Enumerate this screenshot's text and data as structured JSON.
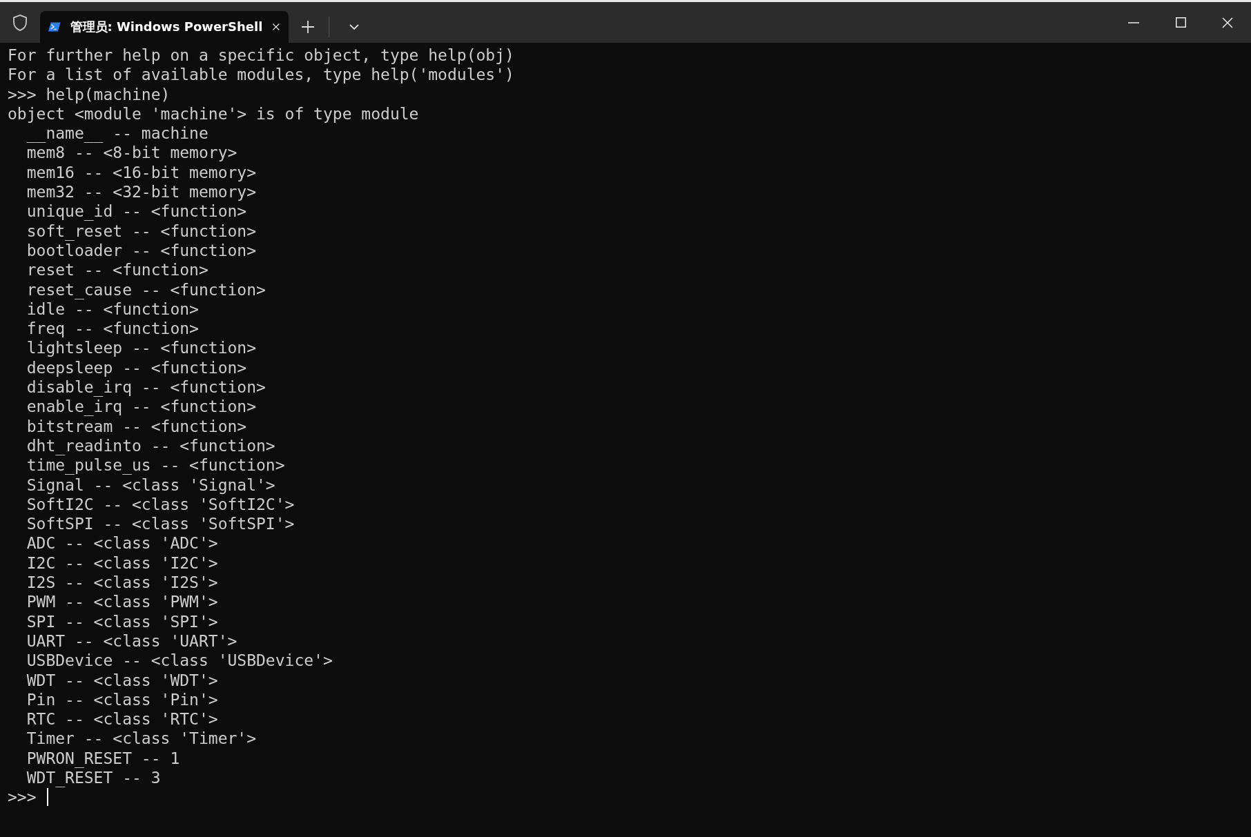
{
  "tab": {
    "title": "管理员: Windows PowerShell",
    "selected": true
  },
  "terminal": {
    "lines": [
      "For further help on a specific object, type help(obj)",
      "For a list of available modules, type help('modules')",
      ">>> help(machine)",
      "object <module 'machine'> is of type module",
      "  __name__ -- machine",
      "  mem8 -- <8-bit memory>",
      "  mem16 -- <16-bit memory>",
      "  mem32 -- <32-bit memory>",
      "  unique_id -- <function>",
      "  soft_reset -- <function>",
      "  bootloader -- <function>",
      "  reset -- <function>",
      "  reset_cause -- <function>",
      "  idle -- <function>",
      "  freq -- <function>",
      "  lightsleep -- <function>",
      "  deepsleep -- <function>",
      "  disable_irq -- <function>",
      "  enable_irq -- <function>",
      "  bitstream -- <function>",
      "  dht_readinto -- <function>",
      "  time_pulse_us -- <function>",
      "  Signal -- <class 'Signal'>",
      "  SoftI2C -- <class 'SoftI2C'>",
      "  SoftSPI -- <class 'SoftSPI'>",
      "  ADC -- <class 'ADC'>",
      "  I2C -- <class 'I2C'>",
      "  I2S -- <class 'I2S'>",
      "  PWM -- <class 'PWM'>",
      "  SPI -- <class 'SPI'>",
      "  UART -- <class 'UART'>",
      "  USBDevice -- <class 'USBDevice'>",
      "  WDT -- <class 'WDT'>",
      "  Pin -- <class 'Pin'>",
      "  RTC -- <class 'RTC'>",
      "  Timer -- <class 'Timer'>",
      "  PWRON_RESET -- 1",
      "  WDT_RESET -- 3"
    ],
    "prompt": ">>> "
  }
}
